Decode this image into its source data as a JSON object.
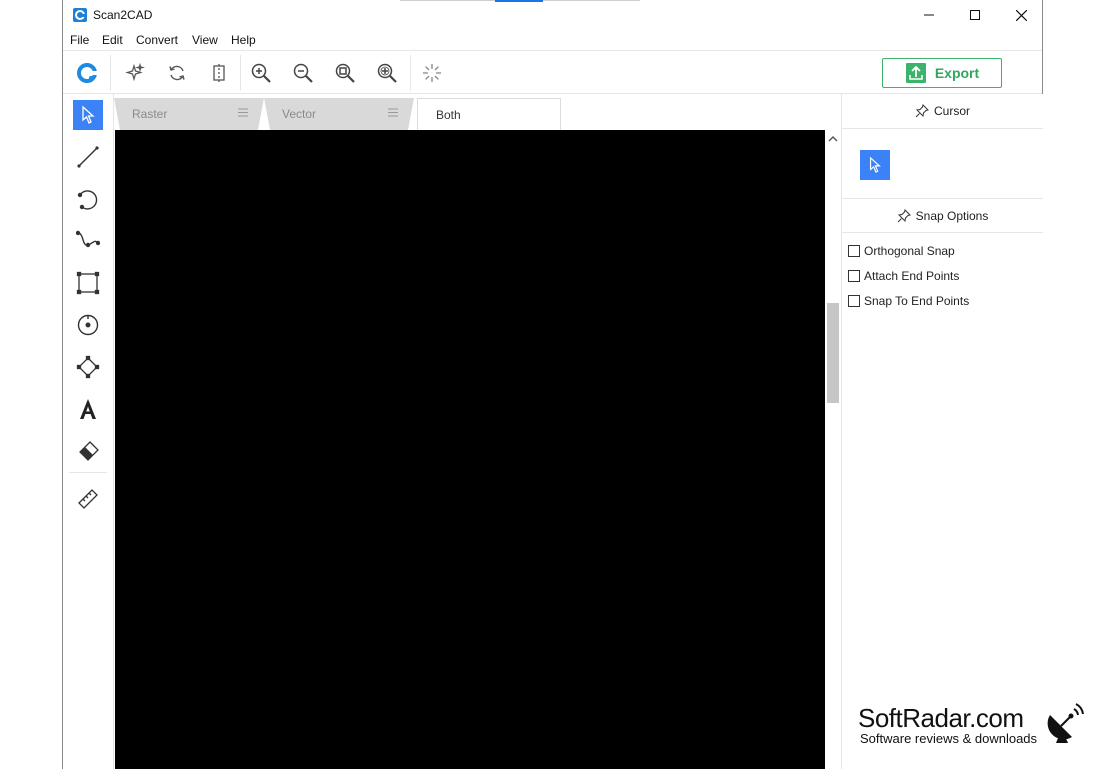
{
  "window": {
    "title": "Scan2CAD",
    "controls": {
      "minimize": "minimize",
      "maximize": "maximize",
      "close": "close"
    }
  },
  "menubar": {
    "items": [
      "File",
      "Edit",
      "Convert",
      "View",
      "Help"
    ]
  },
  "toolbar": {
    "icons": [
      "scan2cad-logo-icon",
      "sparkle-icon",
      "refresh-icon",
      "crop-icon",
      "zoom-in-icon",
      "zoom-out-icon",
      "zoom-fit-icon",
      "zoom-area-icon",
      "loading-icon"
    ],
    "export_label": "Export"
  },
  "tools": {
    "items": [
      "cursor-tool-icon",
      "line-tool-icon",
      "arc-tool-icon",
      "curve-tool-icon",
      "rectangle-tool-icon",
      "circle-tool-icon",
      "polygon-tool-icon",
      "text-tool-icon",
      "eraser-tool-icon",
      "measure-tool-icon"
    ],
    "active": "cursor-tool-icon"
  },
  "tabs": [
    {
      "label": "Raster",
      "active": false
    },
    {
      "label": "Vector",
      "active": false
    },
    {
      "label": "Both",
      "active": true
    }
  ],
  "right_panel": {
    "cursor_header": "Cursor",
    "snap_header": "Snap Options",
    "snap_options": [
      {
        "label": "Orthogonal Snap",
        "checked": false
      },
      {
        "label": "Attach End Points",
        "checked": false
      },
      {
        "label": "Snap To End Points",
        "checked": false
      }
    ]
  },
  "watermark": {
    "title": "SoftRadar.com",
    "subtitle": "Software reviews & downloads"
  },
  "colors": {
    "accent": "#3b82f6",
    "export": "#2ea85e",
    "canvas": "#000000"
  }
}
